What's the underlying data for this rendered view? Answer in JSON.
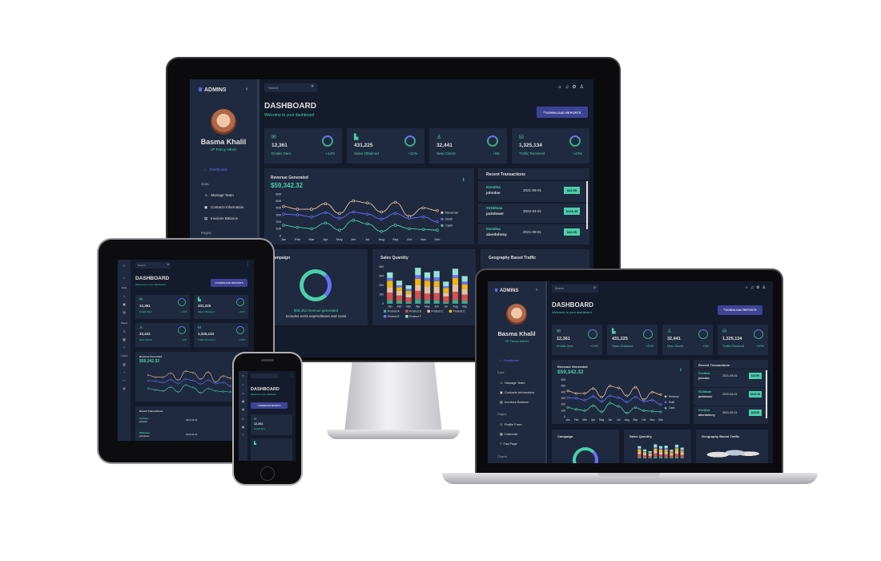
{
  "brand": "ADMINS",
  "search_placeholder": "Search",
  "user": {
    "name": "Basma Khalil",
    "role": "VP Fancy Admin"
  },
  "page": {
    "title": "DASHBOARD",
    "subtitle": "Welcome to your dashboard"
  },
  "download_label": "DOWNLOAD REPORTS",
  "nav": {
    "dashboard": "Dashboard",
    "section_data": "Data",
    "manage_team": "Manage Team",
    "contacts": "Contacts Information",
    "invoices": "Invoices Balance",
    "section_pages": "Pages",
    "profile": "Profile Form",
    "calendar": "Calendar",
    "faq": "Faq Page",
    "section_charts": "Charts"
  },
  "stats": [
    {
      "value": "12,361",
      "label": "Emails Sent",
      "change": "+14%",
      "icon": "email-icon"
    },
    {
      "value": "431,225",
      "label": "Sales Obtained",
      "change": "+21%",
      "icon": "point-of-sale-icon"
    },
    {
      "value": "32,441",
      "label": "New Clients",
      "change": "+5%",
      "icon": "person-add-icon"
    },
    {
      "value": "1,325,134",
      "label": "Traffic Received",
      "change": "+43%",
      "icon": "traffic-icon"
    }
  ],
  "revenue": {
    "title": "Revenue Generated",
    "amount": "$59,342.32"
  },
  "transactions": {
    "title": "Recent Transactions",
    "items": [
      {
        "id": "01e4dsa",
        "user": "johndoe",
        "date": "2021-09-01",
        "cost": "$43.95"
      },
      {
        "id": "0315dsaa",
        "user": "jackdower",
        "date": "2022-04-01",
        "cost": "$133.45"
      },
      {
        "id": "01e4dsa",
        "user": "aberdohnny",
        "date": "2021-09-01",
        "cost": "$43.95"
      }
    ]
  },
  "campaign": {
    "title": "Campaign",
    "revenue_text": "$48,352 revenue generated",
    "note": "Includes extra expenditures and costs"
  },
  "sales_quantity": {
    "title": "Sales Quantity"
  },
  "geography": {
    "title": "Geography Based Traffic"
  },
  "colors": {
    "bg": "#141b2d",
    "panel": "#1f2a40",
    "accent": "#4cceac",
    "button": "#3e4396",
    "blue": "#6870fa",
    "red": "#db4f4a"
  },
  "chart_data": [
    {
      "type": "line",
      "title": "Revenue Generated",
      "categories": [
        "Jan",
        "Feb",
        "Mar",
        "Apr",
        "May",
        "Jun",
        "Jul",
        "Aug",
        "Sep",
        "Oct",
        "Nov",
        "Dec"
      ],
      "ylim": [
        0,
        600
      ],
      "yticks": [
        "0",
        "100",
        "200",
        "300",
        "400",
        "500",
        "600"
      ],
      "series": [
        {
          "name": "Revenue",
          "color": "#e8c1a0",
          "values": [
            420,
            380,
            380,
            460,
            320,
            500,
            470,
            340,
            480,
            280,
            400,
            360
          ]
        },
        {
          "name": "Draft",
          "color": "#6870fa",
          "values": [
            310,
            300,
            270,
            330,
            250,
            340,
            310,
            240,
            320,
            250,
            270,
            200
          ]
        },
        {
          "name": "Cash",
          "color": "#4cceac",
          "values": [
            150,
            120,
            100,
            180,
            80,
            220,
            170,
            60,
            150,
            100,
            90,
            80
          ]
        }
      ]
    },
    {
      "type": "bar",
      "title": "Sales Quantity",
      "categories": [
        "Jan",
        "Feb",
        "Mar",
        "Apr",
        "May",
        "Jun",
        "Jul",
        "Aug",
        "Sep"
      ],
      "ylim": [
        0,
        400
      ],
      "series": [
        {
          "name": "Product A",
          "color": "#3da58a",
          "values": [
            40,
            30,
            20,
            50,
            40,
            35,
            20,
            40,
            30
          ]
        },
        {
          "name": "Product B",
          "color": "#db4f4a",
          "values": [
            80,
            60,
            50,
            90,
            70,
            80,
            60,
            90,
            70
          ]
        },
        {
          "name": "Product C",
          "color": "#e8c1a0",
          "values": [
            60,
            50,
            40,
            60,
            80,
            70,
            40,
            80,
            60
          ]
        },
        {
          "name": "Product D",
          "color": "#f2b705",
          "values": [
            70,
            40,
            30,
            70,
            60,
            60,
            50,
            70,
            50
          ]
        },
        {
          "name": "Product E",
          "color": "#6870fa",
          "values": [
            30,
            20,
            20,
            40,
            30,
            40,
            20,
            30,
            30
          ]
        },
        {
          "name": "Product F",
          "color": "#97e3d5",
          "values": [
            60,
            50,
            40,
            80,
            60,
            70,
            50,
            70,
            60
          ]
        }
      ]
    }
  ]
}
